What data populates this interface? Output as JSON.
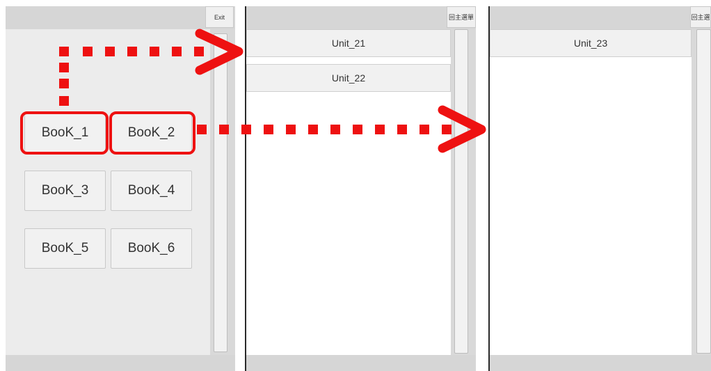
{
  "panel_books": {
    "exit_label": "Exit",
    "books": [
      {
        "label": "BooK_1",
        "highlighted": true
      },
      {
        "label": "BooK_2",
        "highlighted": true
      },
      {
        "label": "BooK_3",
        "highlighted": false
      },
      {
        "label": "BooK_4",
        "highlighted": false
      },
      {
        "label": "BooK_5",
        "highlighted": false
      },
      {
        "label": "BooK_6",
        "highlighted": false
      }
    ]
  },
  "panel_units_a": {
    "main_menu_label": "回主選單",
    "units": [
      "Unit_21",
      "Unit_22"
    ]
  },
  "panel_units_b": {
    "main_menu_label": "回主選",
    "units": [
      "Unit_23"
    ]
  },
  "colors": {
    "highlight": "#ee1111",
    "panel_bg": "#ececec",
    "bar_bg": "#d6d6d6"
  }
}
